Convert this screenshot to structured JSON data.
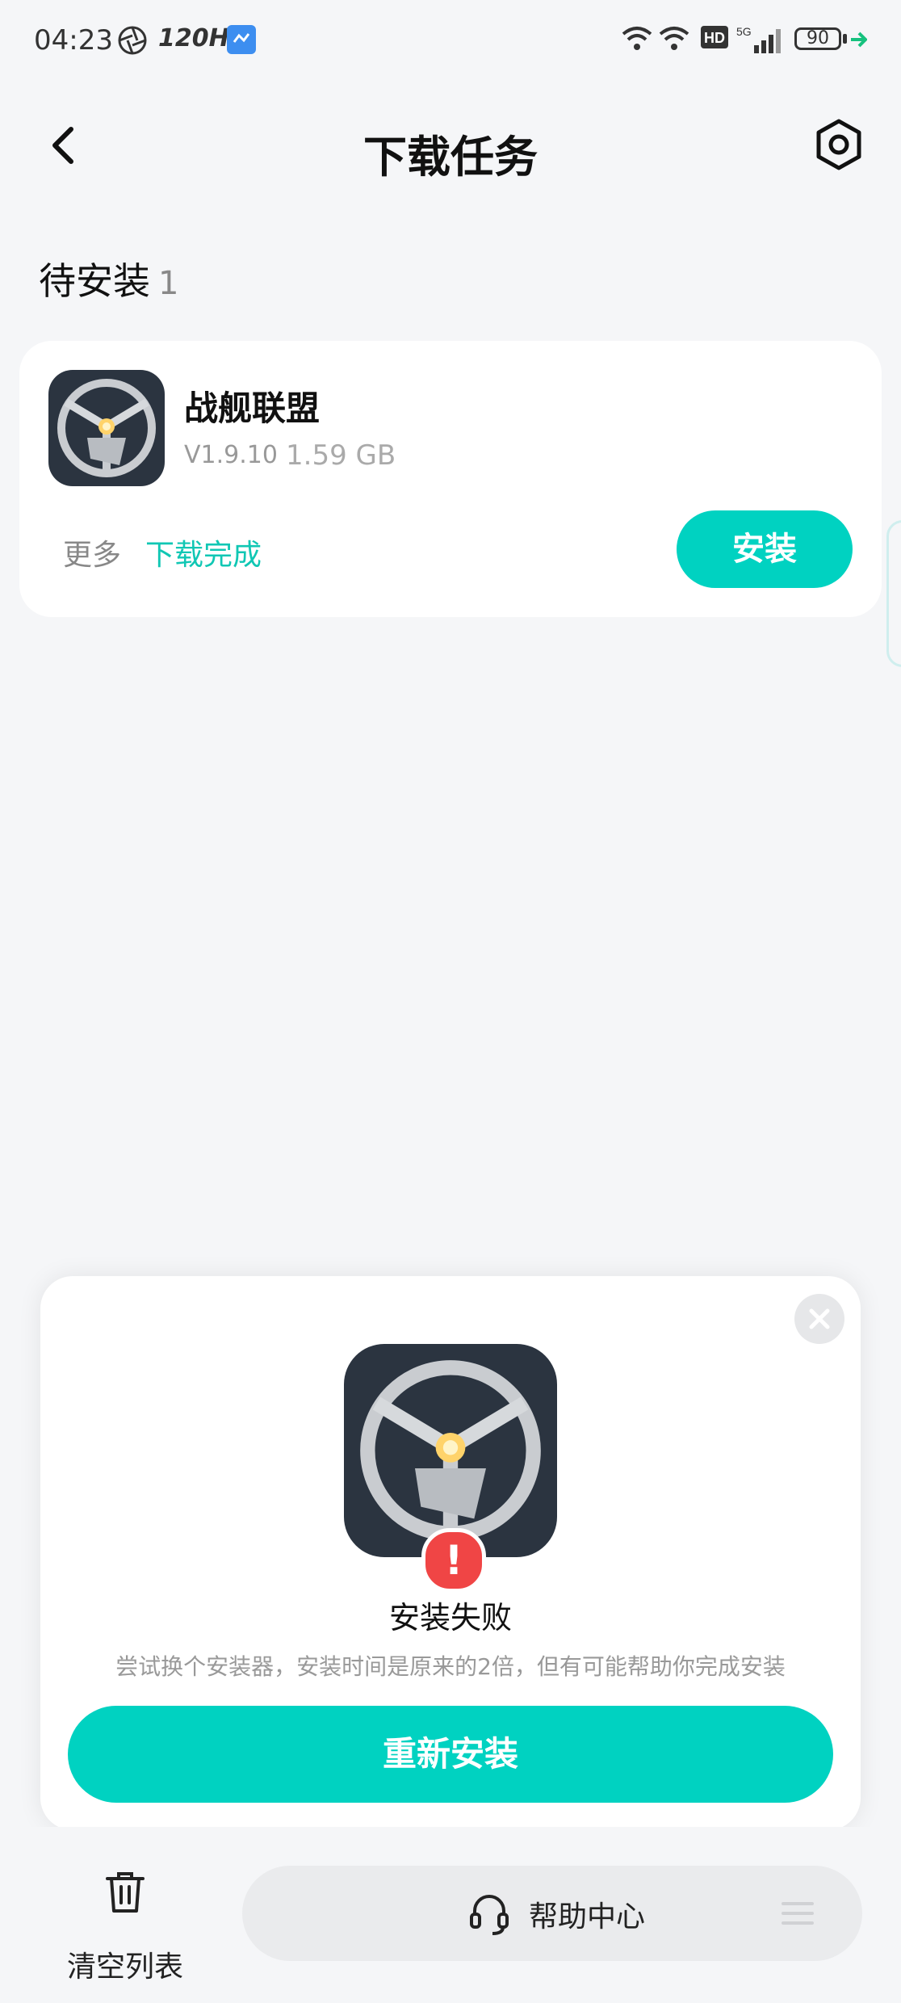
{
  "status_bar": {
    "time": "04:23",
    "refresh_rate": "120Hz",
    "battery": "90",
    "icons": [
      "aperture-icon",
      "refresh-rate-icon",
      "screen-share-icon",
      "wifi-icon",
      "wifi-icon",
      "hd-icon",
      "5g-signal-icon",
      "battery-icon",
      "charging-icon"
    ]
  },
  "header": {
    "title": "下载任务"
  },
  "section": {
    "title": "待安装",
    "count": "1"
  },
  "task": {
    "name": "战舰联盟",
    "version": "V1.9.10",
    "size": "1.59 GB",
    "more_label": "更多",
    "status": "下载完成",
    "install_label": "安装"
  },
  "dialog": {
    "title": "安装失败",
    "description": "尝试换个安装器，安装时间是原来的2倍，但有可能帮助你完成安装",
    "reinstall_label": "重新安装",
    "error_glyph": "!"
  },
  "bottom": {
    "clear_label": "清空列表",
    "help_label": "帮助中心"
  },
  "colors": {
    "accent": "#00d2c1",
    "error": "#f04545",
    "background": "#f5f6f8"
  }
}
